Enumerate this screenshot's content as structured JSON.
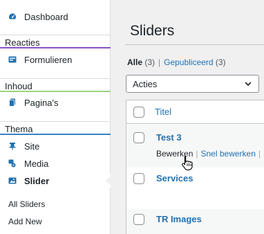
{
  "sidebar": {
    "dashboard": {
      "label": "Dashboard",
      "icon": "dashboard-icon"
    },
    "sections": {
      "reacties": "Reacties",
      "inhoud": "Inhoud",
      "thema": "Thema"
    },
    "formulieren": {
      "label": "Formulieren",
      "icon": "forms-icon"
    },
    "paginas": {
      "label": "Pagina's",
      "icon": "pages-icon"
    },
    "site": {
      "label": "Site",
      "icon": "pin-icon"
    },
    "media": {
      "label": "Media",
      "icon": "media-icon"
    },
    "slider": {
      "label": "Slider",
      "icon": "slider-icon"
    },
    "submenu": [
      "All Sliders",
      "Add New"
    ]
  },
  "main": {
    "title": "Sliders",
    "filters": {
      "all_label": "Alle",
      "all_count": "(3)",
      "separator": "|",
      "published_label": "Gepubliceerd",
      "published_count": "(3)"
    },
    "bulk_actions": {
      "selected": "Acties"
    },
    "table": {
      "column_title": "Titel",
      "rows": [
        {
          "title": "Test 3",
          "actions": [
            "Bewerken",
            "Snel bewerken",
            "|"
          ]
        },
        {
          "title": "Services"
        },
        {
          "title": "TR Images"
        }
      ]
    }
  },
  "colors": {
    "accent_link": "#2271b1",
    "reacties_rule": "#8d52c9",
    "inhoud_rule": "#9ad57f",
    "thema_rule": "#3582c4"
  }
}
